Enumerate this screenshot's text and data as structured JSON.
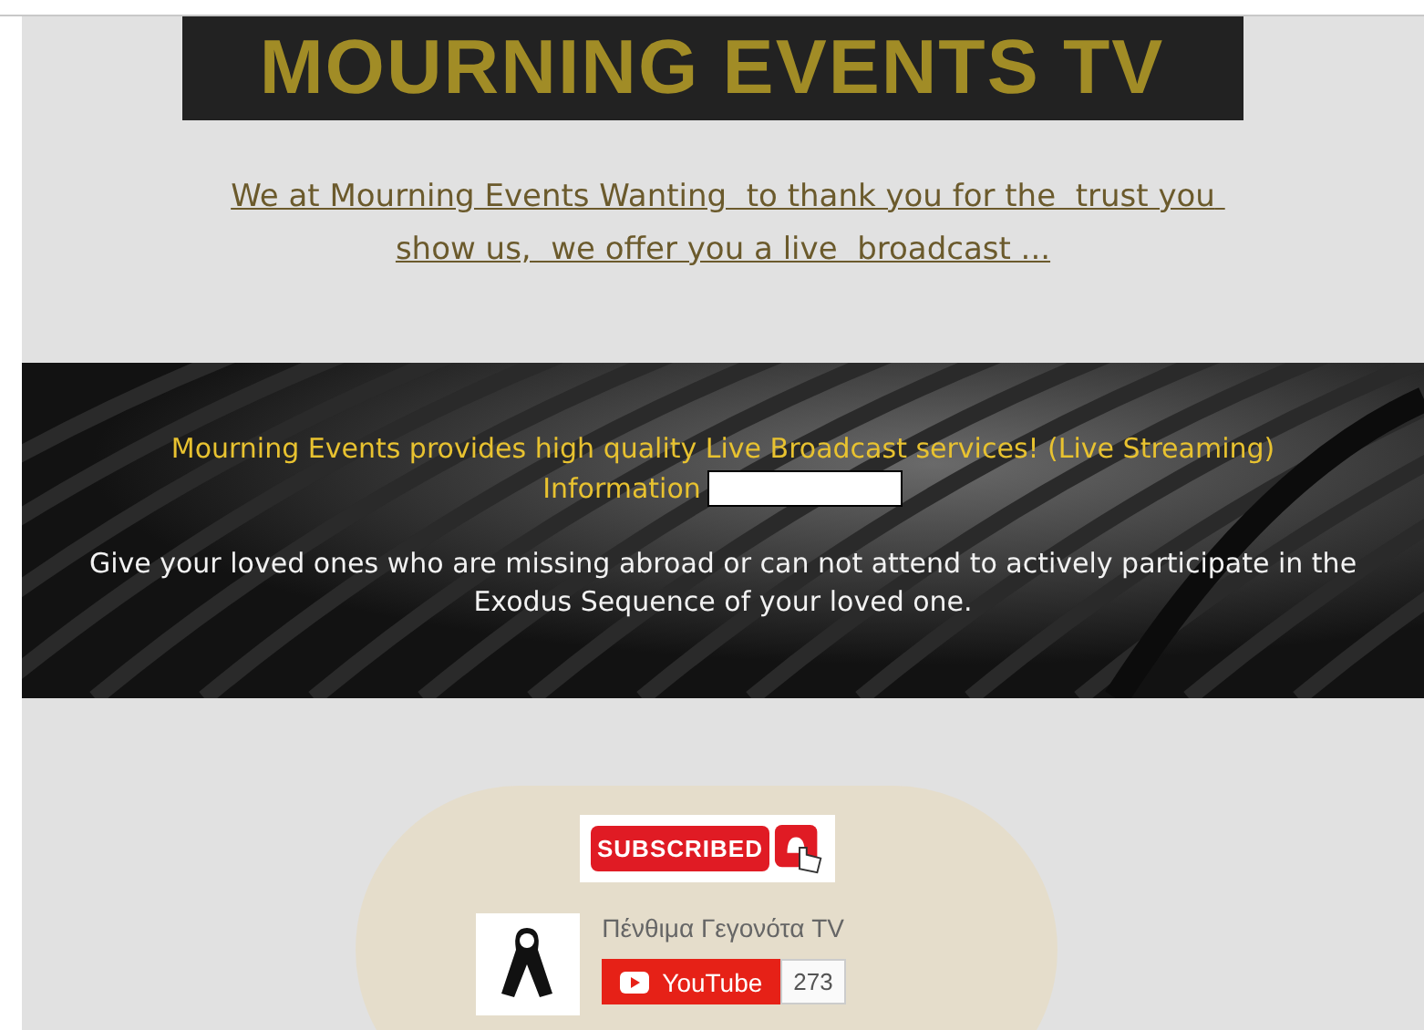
{
  "header": {
    "title": "MOURNING EVENTS TV"
  },
  "intro_link": "We at Mourning Events Wanting  to thank you for the  trust you show us,  we offer you a live  broadcast ...",
  "banner": {
    "headline": "Mourning Events provides high quality Live Broadcast services! (Live Streaming)",
    "info_label": "Information",
    "body": "Give your loved ones who are missing abroad or can not attend to actively participate in the Exodus Sequence of your loved one."
  },
  "subscribe": {
    "button": "SUBSCRIBED",
    "channel_name": "Πένθιμα Γεγονότα TV",
    "youtube_label": "YouTube",
    "subscriber_count": "273"
  }
}
